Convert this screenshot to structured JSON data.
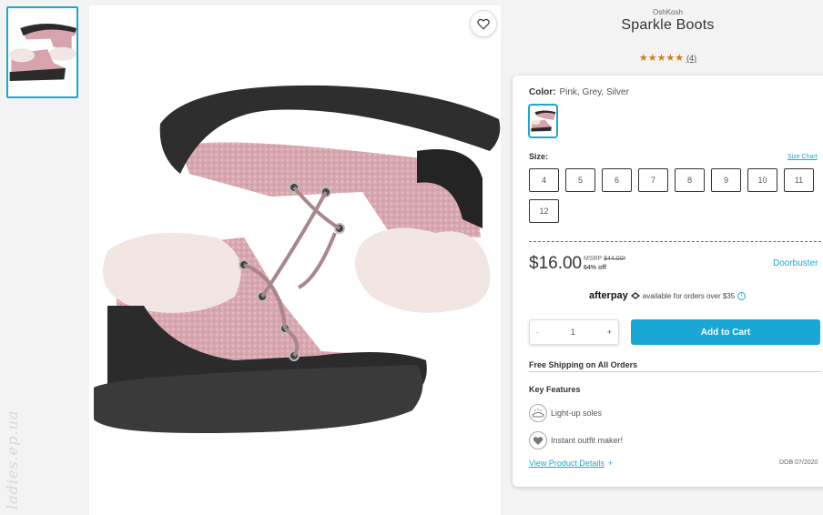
{
  "product": {
    "brand": "OshKosh",
    "title": "Sparkle Boots",
    "stars": "★★★★★",
    "review_count": "(4)",
    "rating": 5
  },
  "watermark": "ladies.ep.ua",
  "color": {
    "label": "Color:",
    "value": "Pink, Grey, Silver"
  },
  "size": {
    "label": "Size:",
    "chart_link": "Size Chart",
    "options": [
      "4",
      "5",
      "6",
      "7",
      "8",
      "9",
      "10",
      "11",
      "12"
    ]
  },
  "pricing": {
    "price": "$16.00",
    "msrp_label": "MSRP",
    "msrp": "$44.00*",
    "discount": "64% off",
    "badge": "Doorbuster"
  },
  "afterpay": {
    "logo": "afterpay",
    "text": "available for orders over $35",
    "info_glyph": "i"
  },
  "cart": {
    "minus": "-",
    "quantity": "1",
    "plus": "+",
    "button": "Add to Cart"
  },
  "shipping": "Free Shipping on All Orders",
  "features": {
    "title": "Key Features",
    "items": [
      "Light-up soles",
      "Instant outfit maker!"
    ]
  },
  "details": {
    "link": "View Product Details",
    "plus": "+",
    "dob": "DOB 07/2020"
  },
  "colors": {
    "accent": "#1ba7d6",
    "star": "#d27e12",
    "boot_pink": "#d7a3ac",
    "boot_black": "#2b2b2b",
    "fur": "#f1e6e2"
  },
  "icons": [
    "heart-icon",
    "info-icon",
    "light-up-soles-icon",
    "outfit-maker-icon"
  ]
}
